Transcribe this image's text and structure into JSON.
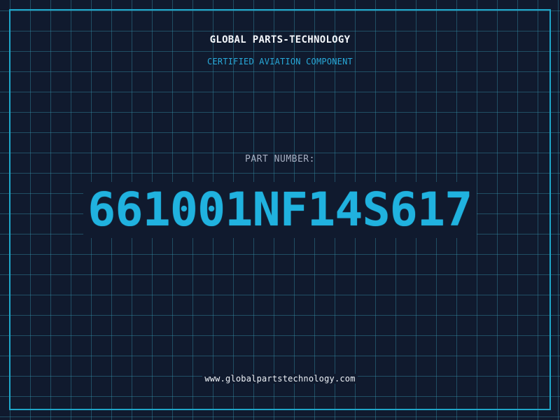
{
  "brand": "GLOBAL PARTS-TECHNOLOGY",
  "tagline": "CERTIFIED AVIATION COMPONENT",
  "part_label": "PART NUMBER:",
  "part_number": "661001NF14S617",
  "website": "www.globalpartstechnology.com",
  "colors": {
    "background": "#101a2e",
    "grid": "#2f8ba6",
    "accent": "#20b2df",
    "text": "#f4f7fb"
  }
}
